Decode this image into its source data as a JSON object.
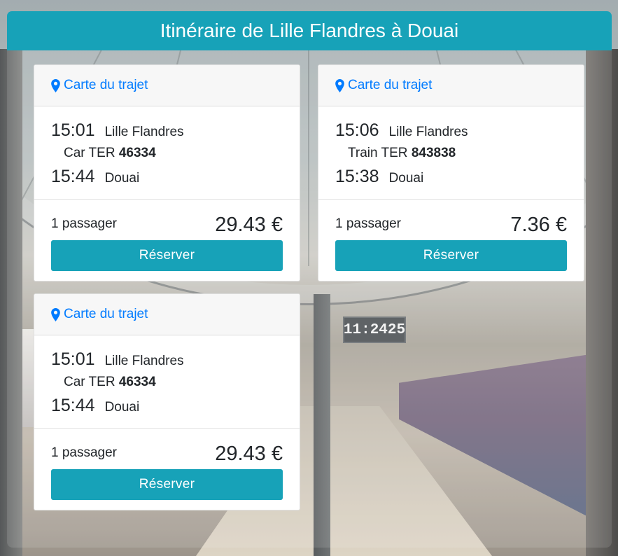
{
  "header": {
    "title": "Itinéraire de Lille Flandres à Douai"
  },
  "background": {
    "clock_text": "11:2425"
  },
  "colors": {
    "accent": "#17a2b8",
    "link": "#007bff"
  },
  "results": [
    {
      "map_label": "Carte du trajet",
      "map_icon": "map-marker-icon",
      "departure": {
        "time": "15:01",
        "station": "Lille Flandres"
      },
      "vehicle": {
        "type": "Car TER",
        "number": "46334"
      },
      "arrival": {
        "time": "15:44",
        "station": "Douai"
      },
      "passengers": "1 passager",
      "price": "29.43 €",
      "book_label": "Réserver"
    },
    {
      "map_label": "Carte du trajet",
      "map_icon": "map-marker-icon",
      "departure": {
        "time": "15:06",
        "station": "Lille Flandres"
      },
      "vehicle": {
        "type": "Train TER",
        "number": "843838"
      },
      "arrival": {
        "time": "15:38",
        "station": "Douai"
      },
      "passengers": "1 passager",
      "price": "7.36 €",
      "book_label": "Réserver"
    },
    {
      "map_label": "Carte du trajet",
      "map_icon": "map-marker-icon",
      "departure": {
        "time": "15:01",
        "station": "Lille Flandres"
      },
      "vehicle": {
        "type": "Car TER",
        "number": "46334"
      },
      "arrival": {
        "time": "15:44",
        "station": "Douai"
      },
      "passengers": "1 passager",
      "price": "29.43 €",
      "book_label": "Réserver"
    }
  ]
}
